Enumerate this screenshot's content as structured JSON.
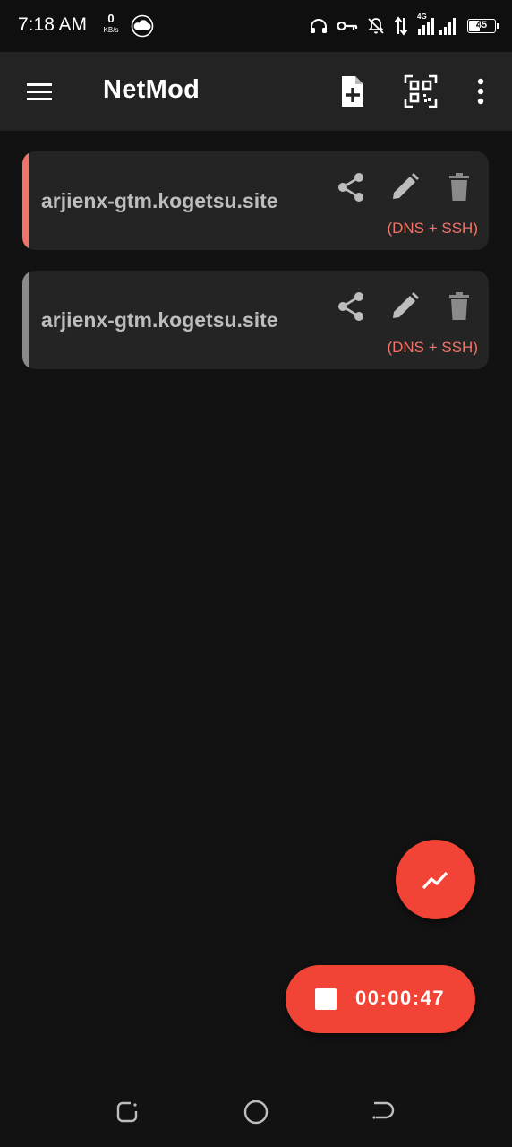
{
  "status_bar": {
    "time": "7:18 AM",
    "net_speed_value": "0",
    "net_speed_unit": "KB/s",
    "network_type": "4G",
    "battery_level": "45",
    "icons": [
      "cloud-icon",
      "headphones-icon",
      "vpn-key-icon",
      "notifications-off-icon",
      "data-arrows-icon",
      "signal-icon",
      "battery-icon"
    ]
  },
  "app_bar": {
    "title": "NetMod",
    "actions": [
      "add-config-icon",
      "qr-scan-icon",
      "more-vert-icon"
    ]
  },
  "configs": [
    {
      "host": "arjienx-gtm.kogetsu.site",
      "protocol": "(DNS + SSH)",
      "active": true,
      "accent_color": "#f07468"
    },
    {
      "host": "arjienx-gtm.kogetsu.site",
      "protocol": "(DNS + SSH)",
      "active": false,
      "accent_color": "#8a8a8a"
    }
  ],
  "fab": {
    "graph_icon": "trending-up-icon",
    "timer": "00:00:47",
    "stop_icon": "stop-icon",
    "color": "#f14336"
  },
  "nav_bar": {
    "buttons": [
      "recents-icon",
      "home-icon",
      "back-icon"
    ]
  }
}
